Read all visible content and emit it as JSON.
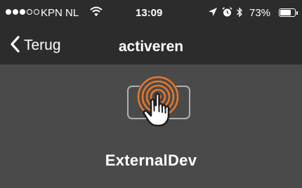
{
  "status_bar": {
    "signal_full": 3,
    "signal_total": 5,
    "carrier": "KPN NL",
    "time": "13:09",
    "battery": "73%",
    "battery_level": 0.73
  },
  "nav": {
    "back_label": "Terug",
    "title": "activeren"
  },
  "content": {
    "device_name": "ExternalDev",
    "icon": "touch-activate-icon"
  },
  "colors": {
    "bar_bg": "#2c2c2c",
    "content_bg": "#4a4a4a",
    "accent": "#e8782a",
    "text": "#ffffff"
  }
}
